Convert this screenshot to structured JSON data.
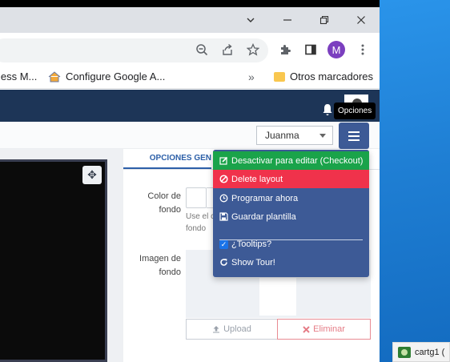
{
  "browser": {
    "bookmarks": {
      "item1": "less M...",
      "item2": "Configure Google A...",
      "overflow": "»",
      "other": "Otros marcadores"
    },
    "avatar_letter": "M"
  },
  "app": {
    "tooltip": "Opciones",
    "user_select": "Juanma",
    "tab_active": "OPCIONES GEN",
    "fields": {
      "color_label_1": "Color de",
      "color_label_2": "fondo",
      "color_hint_1": "Use el c",
      "color_hint_2": "fondo",
      "image_label_1": "Imagen de",
      "image_label_2": "fondo"
    },
    "upload_button": "Upload",
    "delete_button": "Eliminar"
  },
  "dropdown": {
    "items": [
      {
        "label": "Desactivar para editar (Checkout)",
        "icon": "edit-icon"
      },
      {
        "label": "Delete layout",
        "icon": "ban-icon"
      },
      {
        "label": "Programar ahora",
        "icon": "clock-icon"
      },
      {
        "label": "Guardar plantilla",
        "icon": "save-icon"
      },
      {
        "label": "¿Tooltips?",
        "icon": "checkbox-icon"
      },
      {
        "label": "Show Tour!",
        "icon": "refresh-icon"
      }
    ]
  },
  "taskbar": {
    "item_label": "cartg1 ("
  },
  "colors": {
    "header": "#1d3557",
    "menu": "#3d5a96",
    "green": "#1aa34a",
    "red": "#f0324b"
  }
}
